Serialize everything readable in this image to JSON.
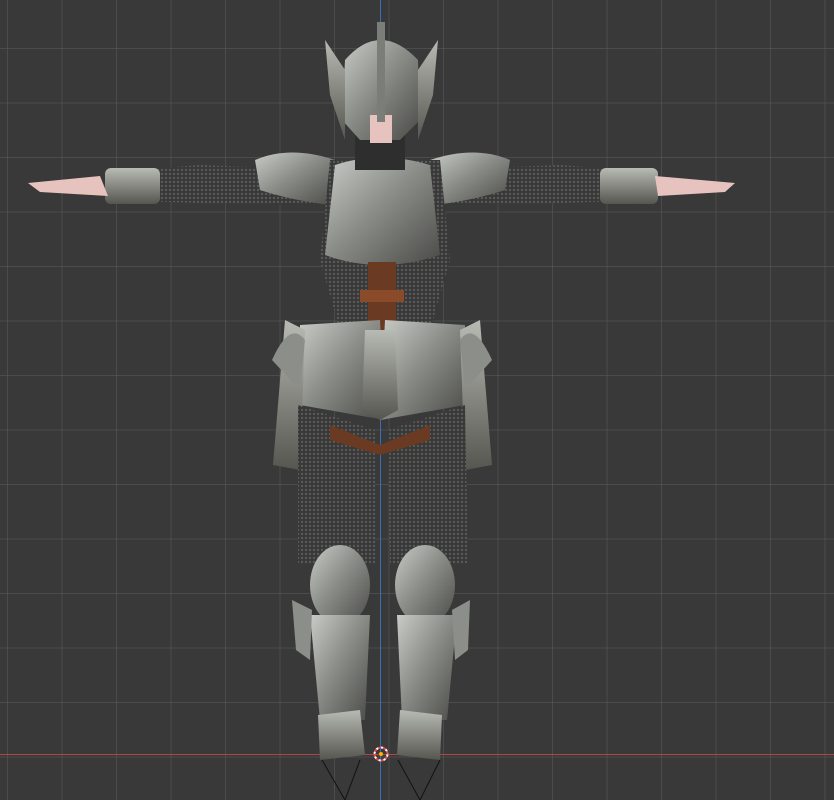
{
  "viewport": {
    "mode": "front-orthographic",
    "background_color": "#393939",
    "grid_color": "#5a5a5a",
    "axis_z_color": "#3a6fb8",
    "axis_x_color": "#b24545"
  },
  "model": {
    "subject": "armored-female-knight",
    "pose": "t-pose",
    "armor_color": "#9a9c98",
    "chainmail_color": "#3c3c3c",
    "leather_color": "#6b3a22",
    "skin_color": "#e7c3c0"
  },
  "origin": {
    "icon": "origin-crosshair-icon",
    "colors": [
      "#e24b4b",
      "#ffffff",
      "#ffb000"
    ]
  }
}
